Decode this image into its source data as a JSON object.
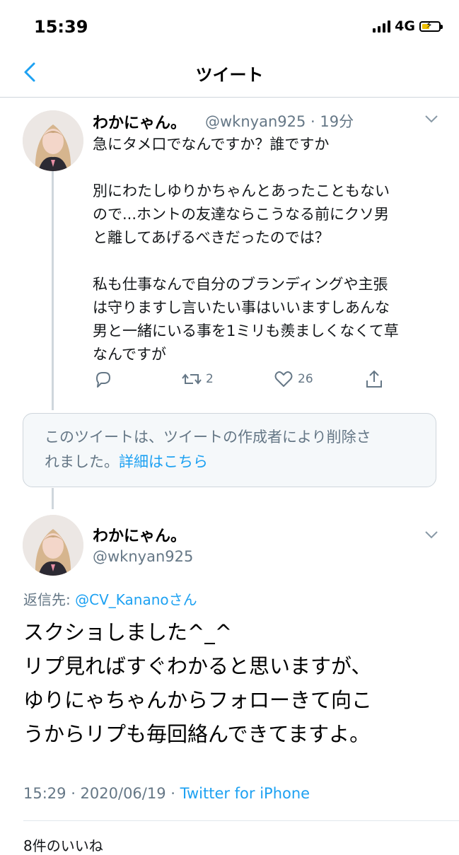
{
  "status_bar": {
    "time": "15:39",
    "network": "4G"
  },
  "header": {
    "title": "ツイート"
  },
  "tweet1": {
    "name": "わかにゃん。",
    "handle_time": "@wknyan925 · 19分",
    "body_lines": [
      "急にタメ口でなんですか？誰ですか",
      "",
      "別にわたしゆりかちゃんとあったこともない",
      "ので...ホントの友達ならこうなる前にクソ男",
      "と離してあげるべきだったのでは？",
      "",
      "私も仕事なんで自分のブランディングや主張",
      "は守りますし言いたい事はいいますしあんな",
      "男と一緒にいる事を1ミリも羨ましくなくて草",
      "なんですが"
    ],
    "retweets": "2",
    "likes": "26"
  },
  "deleted_notice": {
    "text": "このツイートは、ツイートの作成者により削除さ",
    "text2": "れました。",
    "link": "詳細はこちら"
  },
  "tweet2": {
    "name": "わかにゃん。",
    "handle": "@wknyan925",
    "reply_label": "返信先: ",
    "reply_handle": "@CV_Kananoさん",
    "body_lines": [
      "スクショしました^_^",
      "リプ見ればすぐわかると思いますが、",
      "ゆりにゃちゃんからフォローきて向こ",
      "うからリプも毎回絡んできてますよ。"
    ],
    "timestamp": "15:29 · 2020/06/19 · ",
    "source": "Twitter for iPhone",
    "likes_summary": "8件のいいね"
  },
  "colors": {
    "accent": "#1da1f2",
    "muted": "#657786",
    "battery": "#f0c000"
  },
  "icons": [
    "back-chevron-icon",
    "chevron-down-icon",
    "reply-icon",
    "retweet-icon",
    "like-heart-icon",
    "share-icon"
  ]
}
